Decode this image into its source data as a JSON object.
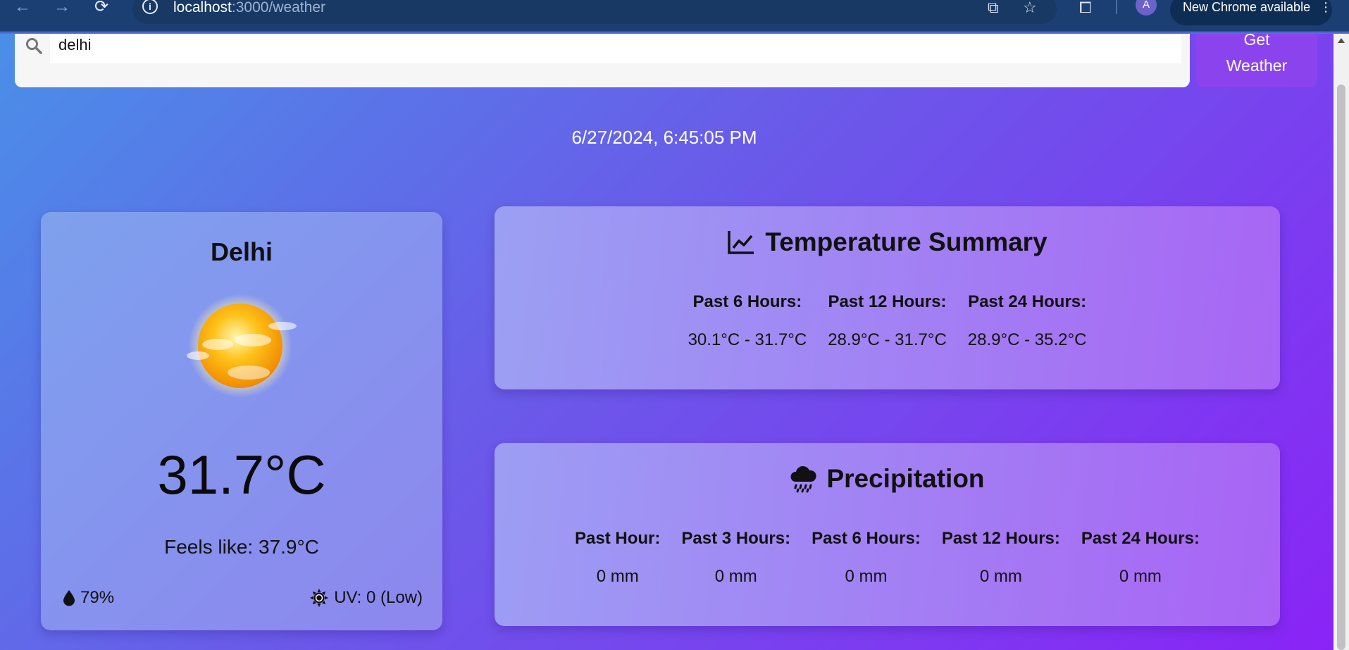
{
  "browser": {
    "url_host": "localhost",
    "url_path": ":3000/weather",
    "avatar_initial": "A",
    "update_label": "New Chrome available"
  },
  "search": {
    "value": "delhi",
    "button_label_line1": "Get",
    "button_label_line2": "Weather"
  },
  "datetime": "6/27/2024, 6:45:05 PM",
  "current": {
    "city": "Delhi",
    "icon": "sun-with-clouds-icon",
    "temperature": "31.7°C",
    "feels_like": "Feels like: 37.9°C",
    "humidity": "79%",
    "uv": "UV: 0 (Low)"
  },
  "temperature_summary": {
    "title": "Temperature Summary",
    "items": [
      {
        "label": "Past 6 Hours:",
        "value": "30.1°C - 31.7°C"
      },
      {
        "label": "Past 12 Hours:",
        "value": "28.9°C - 31.7°C"
      },
      {
        "label": "Past 24 Hours:",
        "value": "28.9°C - 35.2°C"
      }
    ]
  },
  "precipitation": {
    "title": "Precipitation",
    "items": [
      {
        "label": "Past Hour:",
        "value": "0 mm"
      },
      {
        "label": "Past 3 Hours:",
        "value": "0 mm"
      },
      {
        "label": "Past 6 Hours:",
        "value": "0 mm"
      },
      {
        "label": "Past 12 Hours:",
        "value": "0 mm"
      },
      {
        "label": "Past 24 Hours:",
        "value": "0 mm"
      }
    ]
  }
}
